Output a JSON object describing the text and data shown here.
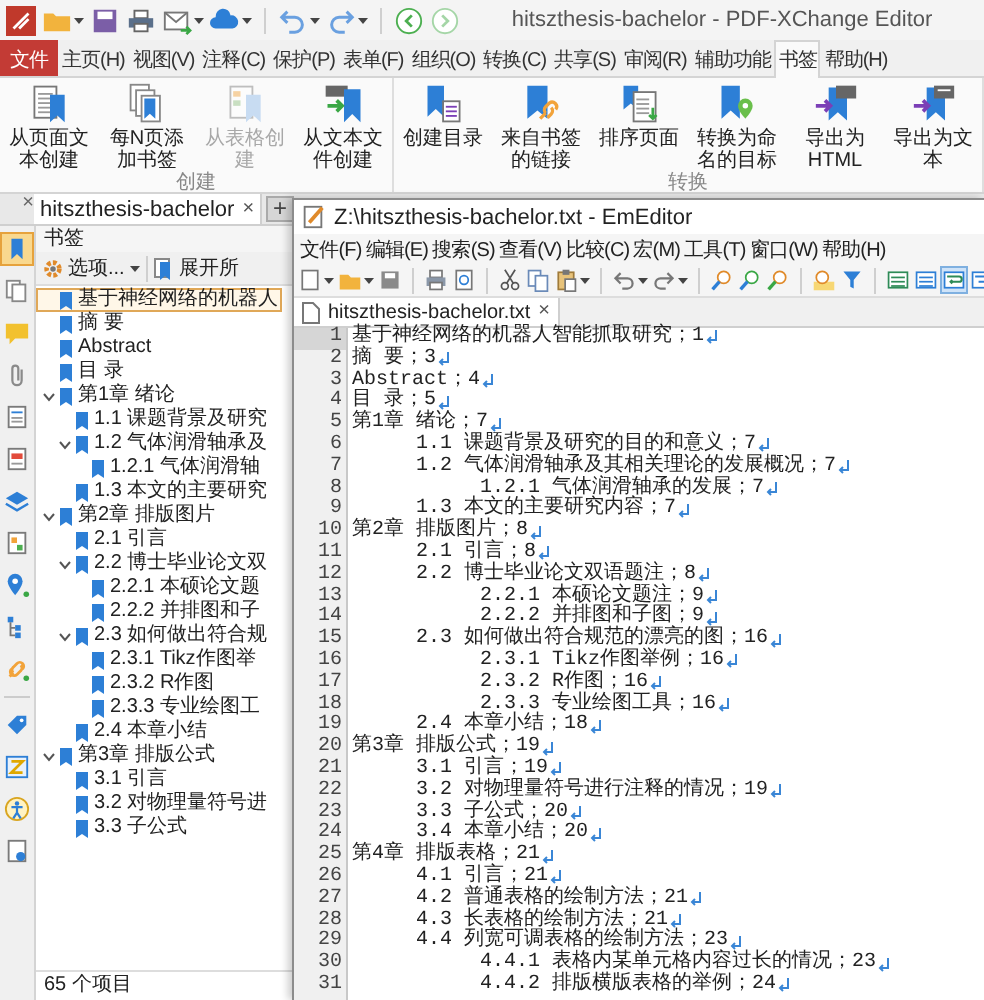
{
  "app": {
    "title": "hitszthesis-bachelor - PDF-XChange Editor"
  },
  "ribbon_tabs": [
    {
      "label": "文件",
      "kind": "file",
      "selected": false
    },
    {
      "label": "主页(H)",
      "kind": "tab",
      "selected": false
    },
    {
      "label": "视图(V)",
      "kind": "tab",
      "selected": false
    },
    {
      "label": "注释(C)",
      "kind": "tab",
      "selected": false
    },
    {
      "label": "保护(P)",
      "kind": "tab",
      "selected": false
    },
    {
      "label": "表单(F)",
      "kind": "tab",
      "selected": false
    },
    {
      "label": "组织(O)",
      "kind": "tab",
      "selected": false
    },
    {
      "label": "转换(C)",
      "kind": "tab",
      "selected": false
    },
    {
      "label": "共享(S)",
      "kind": "tab",
      "selected": false
    },
    {
      "label": "审阅(R)",
      "kind": "tab",
      "selected": false
    },
    {
      "label": "辅助功能",
      "kind": "tab",
      "selected": false
    },
    {
      "label": "书签",
      "kind": "tab",
      "selected": true
    },
    {
      "label": "帮助(H)",
      "kind": "tab",
      "selected": false
    }
  ],
  "ribbon_groups": [
    {
      "label": "创建",
      "buttons": [
        {
          "label": "从页面文本创建",
          "disabled": false
        },
        {
          "label": "每N页添加书签",
          "disabled": false
        },
        {
          "label": "从表格创建",
          "disabled": true
        },
        {
          "label": "从文本文件创建",
          "disabled": false
        }
      ]
    },
    {
      "label": "转换",
      "buttons": [
        {
          "label": "创建目录",
          "disabled": false
        },
        {
          "label": "来自书签的链接",
          "disabled": false
        },
        {
          "label": "排序页面",
          "disabled": false
        },
        {
          "label": "转换为命名的目标",
          "disabled": false
        },
        {
          "label": "导出为 HTML",
          "disabled": false
        },
        {
          "label": "导出为文本",
          "disabled": false
        }
      ]
    }
  ],
  "document_tab": {
    "label": "hitszthesis-bachelor",
    "close": "×"
  },
  "new_tab": "+",
  "side_panel_close": "×",
  "bookmarks_panel": {
    "title": "书签",
    "options": "选项...",
    "expand": "展开所",
    "count": "65 个项目",
    "items": [
      {
        "label": "基于神经网络的机器人",
        "selected": true
      },
      {
        "label": "摘 要",
        "selected": false
      },
      {
        "label": "Abstract",
        "selected": false
      },
      {
        "label": "目 录",
        "selected": false
      },
      {
        "label": "第1章 绪论",
        "selected": false,
        "expanded": true,
        "children": [
          {
            "label": "1.1 课题背景及研究",
            "selected": false
          },
          {
            "label": "1.2 气体润滑轴承及",
            "selected": false,
            "expanded": true,
            "children": [
              {
                "label": "1.2.1 气体润滑轴",
                "selected": false
              }
            ]
          },
          {
            "label": "1.3 本文的主要研究",
            "selected": false
          }
        ]
      },
      {
        "label": "第2章 排版图片",
        "selected": false,
        "expanded": true,
        "children": [
          {
            "label": "2.1 引言",
            "selected": false
          },
          {
            "label": "2.2 博士毕业论文双",
            "selected": false,
            "expanded": true,
            "children": [
              {
                "label": "2.2.1 本硕论文题",
                "selected": false
              },
              {
                "label": "2.2.2 并排图和子",
                "selected": false
              }
            ]
          },
          {
            "label": "2.3 如何做出符合规",
            "selected": false,
            "expanded": true,
            "children": [
              {
                "label": "2.3.1 Tikz作图举",
                "selected": false
              },
              {
                "label": "2.3.2 R作图",
                "selected": false
              },
              {
                "label": "2.3.3 专业绘图工",
                "selected": false
              }
            ]
          },
          {
            "label": "2.4 本章小结",
            "selected": false
          }
        ]
      },
      {
        "label": "第3章 排版公式",
        "selected": false,
        "expanded": true,
        "children": [
          {
            "label": "3.1 引言",
            "selected": false
          },
          {
            "label": "3.2 对物理量符号进",
            "selected": false
          },
          {
            "label": "3.3 子公式",
            "selected": false
          }
        ]
      }
    ]
  },
  "editor": {
    "title": "Z:\\hitszthesis-bachelor.txt - EmEditor",
    "menu": [
      "文件(F)",
      "编辑(E)",
      "搜索(S)",
      "查看(V)",
      "比较(C)",
      "宏(M)",
      "工具(T)",
      "窗口(W)",
      "帮助(H)"
    ],
    "tab": {
      "label": "hitszthesis-bachelor.txt",
      "close": "×"
    },
    "lines": [
      {
        "number": "1",
        "text": "基于神经网络的机器人智能抓取研究；1",
        "current": true
      },
      {
        "number": "2",
        "text": "摘 要；3",
        "current": false
      },
      {
        "number": "3",
        "text": "Abstract；4",
        "current": false
      },
      {
        "number": "4",
        "text": "目 录；5",
        "current": false
      },
      {
        "number": "5",
        "text": "第1章 绪论；7",
        "current": false
      },
      {
        "number": "6",
        "text": "\t1.1 课题背景及研究的目的和意义；7",
        "current": false
      },
      {
        "number": "7",
        "text": "\t1.2 气体润滑轴承及其相关理论的发展概况；7",
        "current": false
      },
      {
        "number": "8",
        "text": "\t\t1.2.1 气体润滑轴承的发展；7",
        "current": false
      },
      {
        "number": "9",
        "text": "\t1.3 本文的主要研究内容；7",
        "current": false
      },
      {
        "number": "10",
        "text": "第2章 排版图片；8",
        "current": false
      },
      {
        "number": "11",
        "text": "\t2.1 引言；8",
        "current": false
      },
      {
        "number": "12",
        "text": "\t2.2 博士毕业论文双语题注；8",
        "current": false
      },
      {
        "number": "13",
        "text": "\t\t2.2.1 本硕论文题注；9",
        "current": false
      },
      {
        "number": "14",
        "text": "\t\t2.2.2 并排图和子图；9",
        "current": false
      },
      {
        "number": "15",
        "text": "\t2.3 如何做出符合规范的漂亮的图；16",
        "current": false
      },
      {
        "number": "16",
        "text": "\t\t2.3.1 Tikz作图举例；16",
        "current": false
      },
      {
        "number": "17",
        "text": "\t\t2.3.2 R作图；16",
        "current": false
      },
      {
        "number": "18",
        "text": "\t\t2.3.3 专业绘图工具；16",
        "current": false
      },
      {
        "number": "19",
        "text": "\t2.4 本章小结；18",
        "current": false
      },
      {
        "number": "20",
        "text": "第3章 排版公式；19",
        "current": false
      },
      {
        "number": "21",
        "text": "\t3.1 引言；19",
        "current": false
      },
      {
        "number": "22",
        "text": "\t3.2 对物理量符号进行注释的情况；19",
        "current": false
      },
      {
        "number": "23",
        "text": "\t3.3 子公式；20",
        "current": false
      },
      {
        "number": "24",
        "text": "\t3.4 本章小结；20",
        "current": false
      },
      {
        "number": "25",
        "text": "第4章 排版表格；21",
        "current": false
      },
      {
        "number": "26",
        "text": "\t4.1 引言；21",
        "current": false
      },
      {
        "number": "27",
        "text": "\t4.2 普通表格的绘制方法；21",
        "current": false
      },
      {
        "number": "28",
        "text": "\t4.3 长表格的绘制方法；21",
        "current": false
      },
      {
        "number": "29",
        "text": "\t4.4 列宽可调表格的绘制方法；23",
        "current": false
      },
      {
        "number": "30",
        "text": "\t\t4.4.1 表格内某单元格内容过长的情况；23",
        "current": false
      },
      {
        "number": "31",
        "text": "\t\t4.4.2 排版横版表格的举例；24",
        "current": false
      }
    ]
  }
}
